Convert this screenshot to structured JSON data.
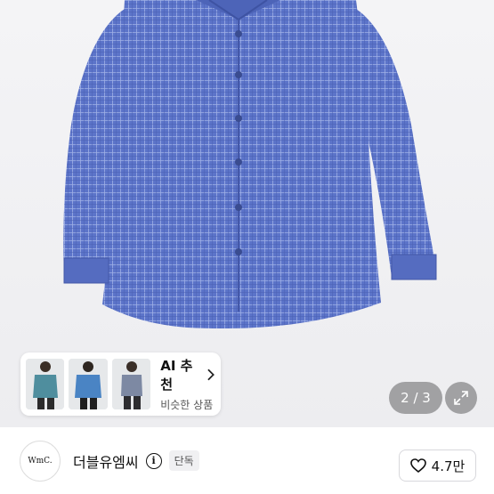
{
  "gallery": {
    "page_indicator": "2 / 3",
    "expand_icon": "expand-arrows-icon",
    "shirt_color": "#5c74c9"
  },
  "ai_recommend": {
    "title": "AI 추천",
    "subtitle": "비슷한 상품",
    "chevron_icon": "chevron-right-icon",
    "thumbnails": [
      "model-teal-shirt",
      "model-blue-shirt",
      "model-gray-shirt"
    ]
  },
  "store": {
    "logo_text": "WmC.",
    "name": "더블유엠씨",
    "badge": "단독",
    "likes": "4.7만"
  }
}
